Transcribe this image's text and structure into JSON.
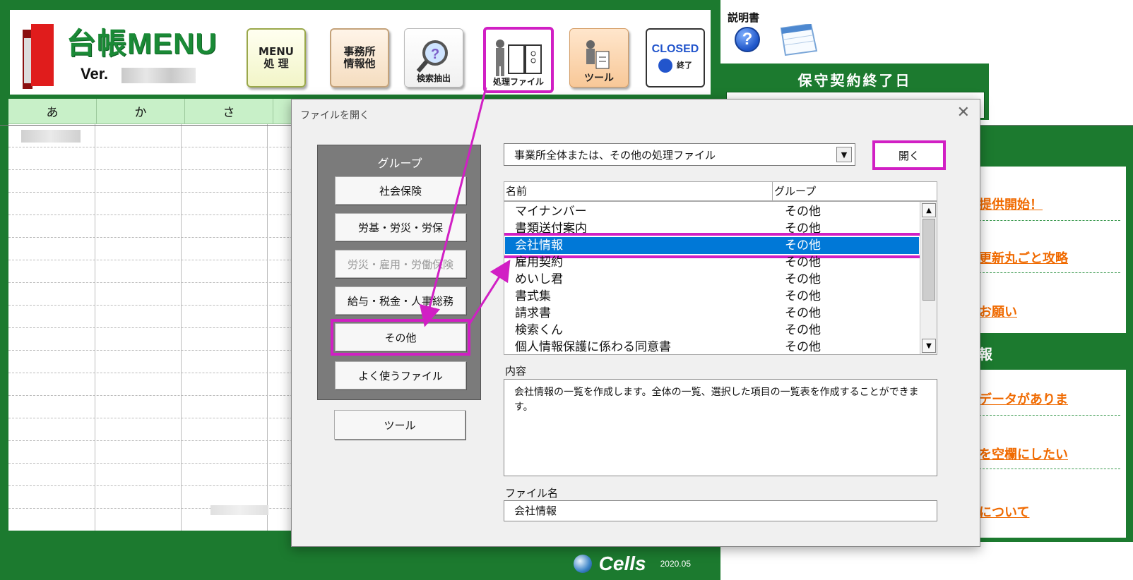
{
  "app": {
    "logo_title": "台帳MENU",
    "version_label": "Ver.",
    "toolbar": [
      {
        "label": "MENU\n処 理",
        "icon": "menu-icon"
      },
      {
        "label": "事務所\n情報他",
        "icon": "office-icon"
      },
      {
        "label": "検索抽出",
        "icon": "magnifier-icon"
      },
      {
        "label": "処理ファイル",
        "icon": "file-icon"
      },
      {
        "label": "ツール",
        "icon": "tool-icon"
      },
      {
        "label": "終了",
        "header": "CLOSED",
        "icon": "exit-icon"
      }
    ],
    "grid_headers": [
      "あ",
      "か",
      "さ"
    ],
    "footer_brand": "Cells",
    "footer_version": "2020.05"
  },
  "side": {
    "manual_label": "説明書",
    "maintenance_title": "保守契約終了日",
    "news_links": [
      "提供開始！",
      "更新丸ごと攻略",
      "お願い"
    ],
    "news_header_2": "報",
    "news_links_2": [
      "データがありま",
      "を空欄にしたい",
      "について"
    ]
  },
  "dialog": {
    "title": "ファイルを開く",
    "group_label": "グループ",
    "groups": [
      {
        "label": "社会保険",
        "state": "normal"
      },
      {
        "label": "労基・労災・労保",
        "state": "normal"
      },
      {
        "label": "労災・雇用・労働保険",
        "state": "disabled"
      },
      {
        "label": "給与・税金・人事総務",
        "state": "normal"
      },
      {
        "label": "その他",
        "state": "selected"
      },
      {
        "label": "よく使うファイル",
        "state": "normal"
      }
    ],
    "tool_button": "ツール",
    "category_value": "事業所全体または、その他の処理ファイル",
    "open_button": "開く",
    "list_columns": {
      "name": "名前",
      "group": "グループ"
    },
    "files": [
      {
        "name": "マイナンバー",
        "group": "その他"
      },
      {
        "name": "書類送付案内",
        "group": "その他"
      },
      {
        "name": "会社情報",
        "group": "その他",
        "selected": true
      },
      {
        "name": "雇用契約",
        "group": "その他"
      },
      {
        "name": "めいし君",
        "group": "その他"
      },
      {
        "name": "書式集",
        "group": "その他"
      },
      {
        "name": "請求書",
        "group": "その他"
      },
      {
        "name": "検索くん",
        "group": "その他"
      },
      {
        "name": "個人情報保護に係わる同意書",
        "group": "その他"
      }
    ],
    "content_label": "内容",
    "content_text": "会社情報の一覧を作成します。全体の一覧、選択した項目の一覧表を作成することができます。",
    "filename_label": "ファイル名",
    "filename_value": "会社情報"
  },
  "colors": {
    "brand_green": "#1c7a2f",
    "highlight_magenta": "#d11fc4",
    "selection_blue": "#0078d7",
    "link_orange": "#f06a00"
  }
}
